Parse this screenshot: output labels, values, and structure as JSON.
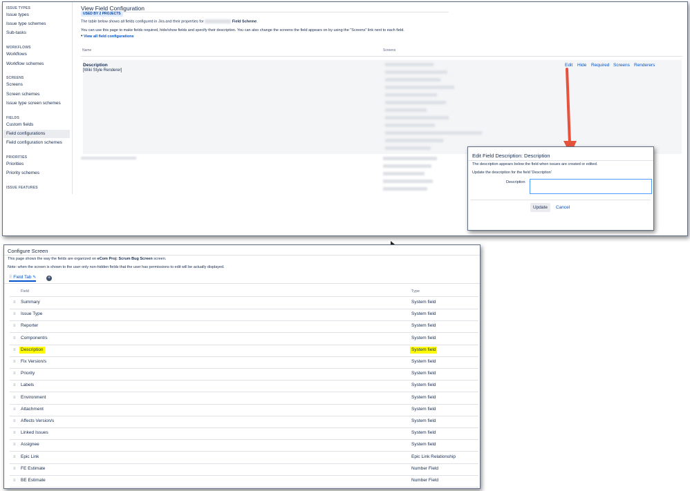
{
  "sidebar": {
    "sections": [
      {
        "header": "ISSUE TYPES",
        "items": [
          {
            "label": "Issue types"
          },
          {
            "label": "Issue type schemes"
          },
          {
            "label": "Sub-tasks"
          }
        ]
      },
      {
        "header": "WORKFLOWS",
        "items": [
          {
            "label": "Workflows"
          },
          {
            "label": "Workflow schemes"
          }
        ]
      },
      {
        "header": "SCREENS",
        "items": [
          {
            "label": "Screens"
          },
          {
            "label": "Screen schemes"
          },
          {
            "label": "Issue type screen schemes"
          }
        ]
      },
      {
        "header": "FIELDS",
        "items": [
          {
            "label": "Custom fields"
          },
          {
            "label": "Field configurations",
            "active": true
          },
          {
            "label": "Field configuration schemes"
          }
        ]
      },
      {
        "header": "PRIORITIES",
        "items": [
          {
            "label": "Priorities"
          },
          {
            "label": "Priority schemes"
          }
        ]
      },
      {
        "header": "ISSUE FEATURES",
        "items": []
      }
    ]
  },
  "field_config": {
    "title": "View Field Configuration",
    "lozenge": "USED BY 2 PROJECTS",
    "intro_text": "The table below shows all fields configured in Jira and their properties for",
    "intro_scheme": "Field Scheme",
    "intro_end": ".",
    "help_text": "You can use this page to make fields required, hide/show fields and specify their description. You can also change the screens the field appears on by using the \"Screens\" link next to each field.",
    "view_all_link": "View all field configurations",
    "col_name": "Name",
    "col_screens": "Screens",
    "row": {
      "name": "Description",
      "renderer": "[Wiki Style Renderer]",
      "ops": [
        "Edit",
        "Hide",
        "Required",
        "Screens",
        "Renderers"
      ]
    }
  },
  "dialog": {
    "title": "Edit Field Description: Description",
    "line1": "The description appears below the field when issues are created or edited.",
    "line2": "Update the description for the field 'Description'",
    "field_label": "Description",
    "field_value": "",
    "update_label": "Update",
    "cancel_label": "Cancel"
  },
  "configure_screen": {
    "title": "Configure Screen",
    "desc_prefix": "This page shows the way the fields are organized on",
    "screen_name": "eCom Proj: Scrum Bug Screen",
    "desc_suffix": "screen.",
    "note": "Note: when the screen is shown to the user only non-hidden fields that the user has permissions to edit will be actually displayed.",
    "tab_label": "Field Tab",
    "col_field": "Field",
    "col_type": "Type",
    "rows": [
      {
        "field": "Summary",
        "type": "System field"
      },
      {
        "field": "Issue Type",
        "type": "System field"
      },
      {
        "field": "Reporter",
        "type": "System field"
      },
      {
        "field": "Component/s",
        "type": "System field"
      },
      {
        "field": "Description",
        "type": "System field",
        "highlight": true
      },
      {
        "field": "Fix Version/s",
        "type": "System field"
      },
      {
        "field": "Priority",
        "type": "System field"
      },
      {
        "field": "Labels",
        "type": "System field"
      },
      {
        "field": "Environment",
        "type": "System field"
      },
      {
        "field": "Attachment",
        "type": "System field"
      },
      {
        "field": "Affects Version/s",
        "type": "System field"
      },
      {
        "field": "Linked Issues",
        "type": "System field"
      },
      {
        "field": "Assignee",
        "type": "System field"
      },
      {
        "field": "Epic Link",
        "type": "Epic Link Relationship"
      },
      {
        "field": "FE Estimate",
        "type": "Number Field"
      },
      {
        "field": "BE Estimate",
        "type": "Number Field"
      }
    ]
  },
  "colors": {
    "link": "#0052cc",
    "highlight": "#fffc00",
    "arrow": "#e5533d"
  }
}
